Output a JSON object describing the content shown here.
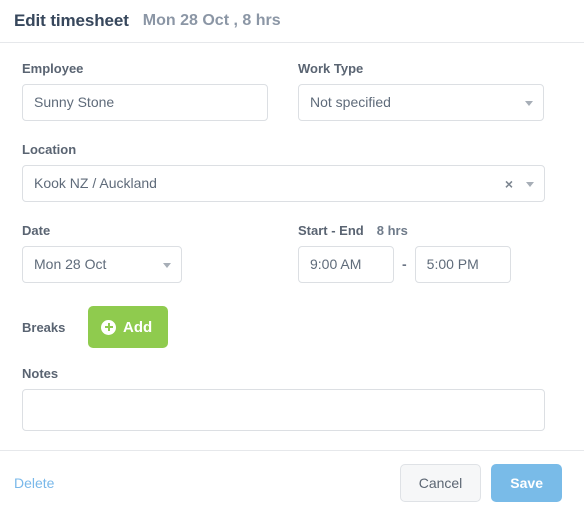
{
  "header": {
    "title": "Edit timesheet",
    "subtitle": "Mon 28 Oct , 8 hrs"
  },
  "form": {
    "employee": {
      "label": "Employee",
      "value": "Sunny Stone"
    },
    "work_type": {
      "label": "Work Type",
      "value": "Not specified",
      "chevron_icon": "chevron-down-icon"
    },
    "location": {
      "label": "Location",
      "value": "Kook NZ / Auckland",
      "clear_icon": "×",
      "chevron_icon": "chevron-down-icon"
    },
    "date": {
      "label": "Date",
      "value": "Mon 28 Oct",
      "chevron_icon": "chevron-down-icon"
    },
    "time": {
      "label": "Start - End",
      "duration": "8 hrs",
      "start_value": "9:00 AM",
      "end_value": "5:00 PM",
      "separator": "-"
    },
    "breaks": {
      "label": "Breaks",
      "add_label": "Add",
      "add_icon": "plus-circle-icon"
    },
    "notes": {
      "label": "Notes",
      "value": "",
      "placeholder": ""
    }
  },
  "footer": {
    "delete_label": "Delete",
    "cancel_label": "Cancel",
    "save_label": "Save"
  },
  "colors": {
    "accent_green": "#8fcb4e",
    "accent_blue": "#79bbe8",
    "title_dark": "#37475c",
    "label_gray": "#5a6472",
    "border_gray": "#dcdfe3"
  }
}
